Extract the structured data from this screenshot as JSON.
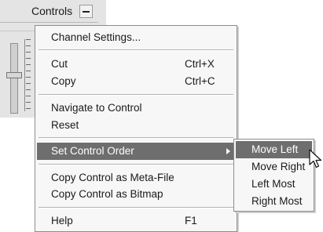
{
  "panel": {
    "title": "Controls",
    "collapse_icon": "minus-icon"
  },
  "context_menu": {
    "items": [
      {
        "label": "Channel Settings...",
        "shortcut": ""
      },
      {
        "label": "Cut",
        "shortcut": "Ctrl+X"
      },
      {
        "label": "Copy",
        "shortcut": "Ctrl+C"
      },
      {
        "label": "Navigate to Control",
        "shortcut": ""
      },
      {
        "label": "Reset",
        "shortcut": ""
      },
      {
        "label": "Set Control Order",
        "shortcut": "",
        "submenu_icon": "chevron-right-icon",
        "highlighted": true
      },
      {
        "label": "Copy Control as Meta-File",
        "shortcut": ""
      },
      {
        "label": "Copy Control as Bitmap",
        "shortcut": ""
      },
      {
        "label": "Help",
        "shortcut": "F1"
      }
    ]
  },
  "submenu": {
    "items": [
      {
        "label": "Move Left",
        "highlighted": true
      },
      {
        "label": "Move Right"
      },
      {
        "label": "Left Most"
      },
      {
        "label": "Right Most"
      }
    ]
  },
  "colors": {
    "highlight": "#6e6e6e",
    "menu_bg": "#f7f7f7",
    "panel_bg": "#e4e4e4"
  },
  "cursor_icon": "arrow-pointer-icon"
}
